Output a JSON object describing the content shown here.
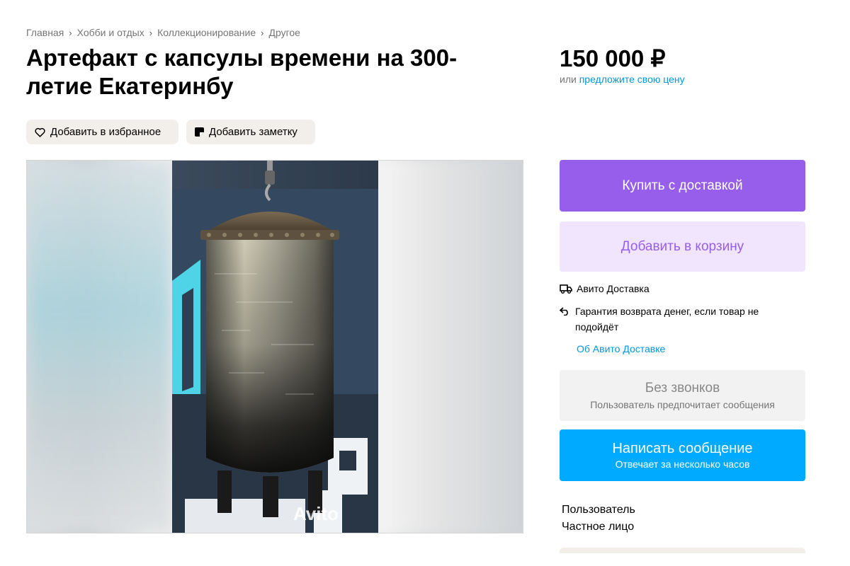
{
  "breadcrumbs": [
    "Главная",
    "Хобби и отдых",
    "Коллекционирование",
    "Другое"
  ],
  "title": "Артефакт с капсулы времени на 300-летие Екатеринбу",
  "price": "150 000 ₽",
  "offer": {
    "prefix": "или",
    "link": "предложите свою цену"
  },
  "actions": {
    "favorite": "Добавить в избранное",
    "note": "Добавить заметку"
  },
  "gallery": {
    "watermark": "Avito"
  },
  "buttons": {
    "buy": "Купить с доставкой",
    "cart": "Добавить в корзину",
    "no_calls_title": "Без звонков",
    "no_calls_subtitle": "Пользователь предпочитает сообщения",
    "message_title": "Написать сообщение",
    "message_subtitle": "Отвечает за несколько часов"
  },
  "delivery": {
    "service": "Авито Доставка",
    "guarantee": "Гарантия возврата денег, если товар не подойдёт",
    "about_link": "Об Авито Доставке"
  },
  "seller": {
    "name": "Пользователь",
    "type": "Частное лицо"
  },
  "icons": {
    "favorite": "heart-icon",
    "note": "note-icon",
    "delivery": "truck-icon",
    "return": "return-arrow-icon",
    "breadcrumb_sep": "chevron-right-icon"
  },
  "colors": {
    "primary_purple": "#965eeb",
    "light_purple": "#f1e5fe",
    "blue": "#00aaff",
    "link": "#0096e0",
    "chip_bg": "#f2eee9"
  }
}
